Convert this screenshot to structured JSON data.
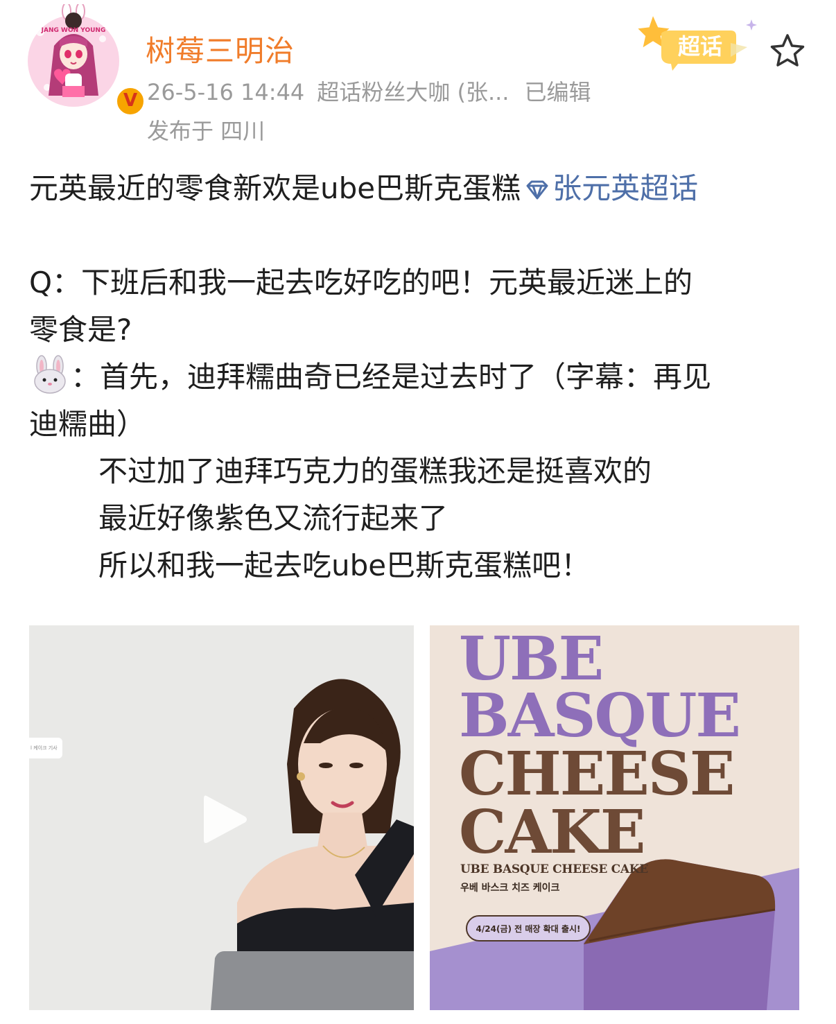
{
  "post": {
    "author": "树莓三明治",
    "avatar_text": "JANG WON YOUNG",
    "verified_badge": "V",
    "timestamp": "26-5-16 14:44",
    "fan_title": "超话粉丝大咖 (张...",
    "edited": "已编辑",
    "location": "发布于 四川",
    "supertopic_tag": "超话",
    "text": {
      "line1": "元英最近的零食新欢是ube巴斯克蛋糕",
      "topic_link": "张元英超话",
      "q_line1": "Q：下班后和我一起去吃好吃的吧！元英最近迷上的",
      "q_line2": "零食是?",
      "a_line1": "：首先，迪拜糯曲奇已经是过去时了（字幕：再见",
      "a_line2": "迪糯曲）",
      "a_line3": "不过加了迪拜巧克力的蛋糕我还是挺喜欢的",
      "a_line4": "最近好像紫色又流行起来了",
      "a_line5": "所以和我一起去吃ube巴斯克蛋糕吧！"
    }
  },
  "media": {
    "video_chip": "l 케이크 기사",
    "poster": {
      "title_lines": [
        "UBE",
        "BASQUE",
        "CHEESE",
        "CAKE"
      ],
      "subtitle": "UBE BASQUE CHEESE CAKE",
      "korean": "우베 바스크 치즈 케이크",
      "pill": "4/24(금) 전 매장 확대 출시!"
    }
  },
  "colors": {
    "author": "#f07c2a",
    "meta": "#9a9a9a",
    "topic_link": "#4e6fa8",
    "ube_purple": "#8e6fb9",
    "poster_brown": "#6e4a36"
  },
  "icons": {
    "star": "star-icon",
    "play": "play-icon",
    "topic": "diamond-icon",
    "rabbit": "rabbit-emoji-icon"
  }
}
